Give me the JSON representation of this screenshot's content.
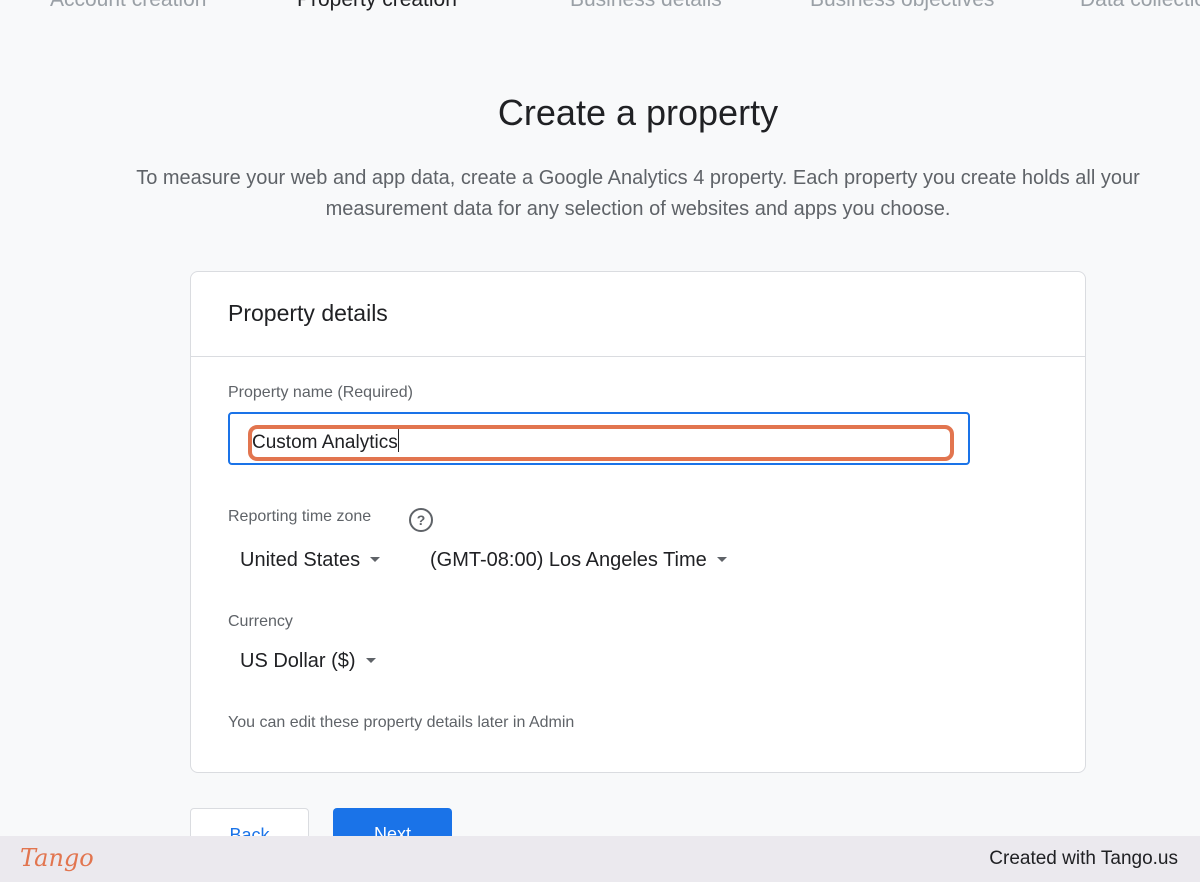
{
  "stepper": {
    "steps": [
      "Account creation",
      "Property creation",
      "Business details",
      "Business objectives",
      "Data collection"
    ]
  },
  "page": {
    "title": "Create a property",
    "intro_line1": "To measure your web and app data, create a Google Analytics 4 property. Each property you create holds all your",
    "intro_line2": "measurement data for any selection of websites and apps you choose."
  },
  "card": {
    "title": "Property details",
    "property_name_label": "Property name (Required)",
    "property_name_value": "Custom Analytics",
    "timezone_label": "Reporting time zone",
    "country_value": "United States",
    "timezone_value": "(GMT-08:00) Los Angeles Time",
    "currency_label": "Currency",
    "currency_value": "US Dollar ($)",
    "note": "You can edit these property details later in Admin"
  },
  "buttons": {
    "back": "Back",
    "next": "Next"
  },
  "footer": {
    "logo_text": "Tango",
    "created_text": "Created with Tango.us"
  },
  "colors": {
    "accent": "#1a73e8",
    "highlight": "#e2754f"
  },
  "icons": {
    "help": "help-icon",
    "dropdown": "arrow-drop-down-icon"
  }
}
